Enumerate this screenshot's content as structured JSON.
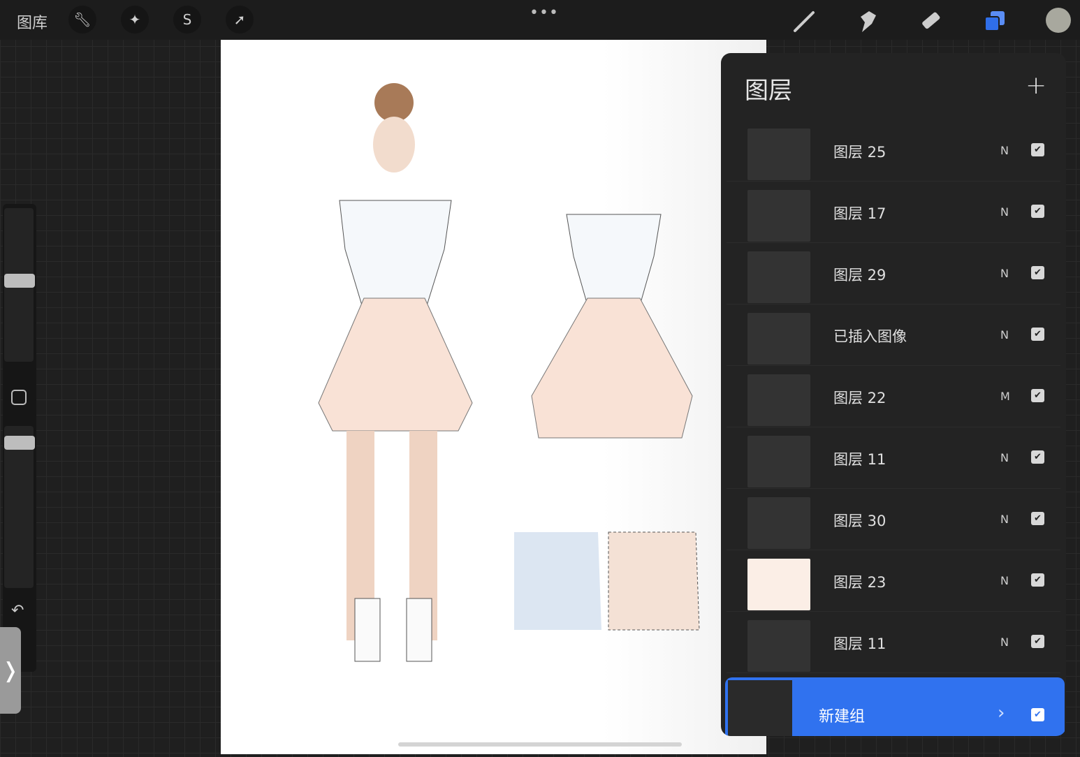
{
  "topbar": {
    "gallery": "图库",
    "menu_dots": "•••",
    "left_tools": [
      "wrench-icon",
      "magic-wand-icon",
      "selection-icon",
      "transform-arrow-icon"
    ],
    "right_tools": [
      "brush-icon",
      "smudge-icon",
      "eraser-icon",
      "layers-icon"
    ],
    "color_swatch": "#a8a89e",
    "accent": "#3072ef"
  },
  "sidebar": {
    "expand": "❭",
    "undo": "↶"
  },
  "layers": {
    "title": "图层",
    "add": "+",
    "items": [
      {
        "name": "图层 25",
        "mode": "N",
        "visible": true
      },
      {
        "name": "图层 17",
        "mode": "N",
        "visible": true
      },
      {
        "name": "图层 29",
        "mode": "N",
        "visible": true
      },
      {
        "name": "已插入图像",
        "mode": "N",
        "visible": true
      },
      {
        "name": "图层 22",
        "mode": "M",
        "visible": true
      },
      {
        "name": "图层 11",
        "mode": "N",
        "visible": true
      },
      {
        "name": "图层 30",
        "mode": "N",
        "visible": true
      },
      {
        "name": "图层 23",
        "mode": "N",
        "visible": true
      },
      {
        "name": "图层 11",
        "mode": "N",
        "visible": true
      }
    ],
    "group": {
      "name": "新建组",
      "arrow": "›",
      "visible": true
    }
  },
  "check": "✔"
}
